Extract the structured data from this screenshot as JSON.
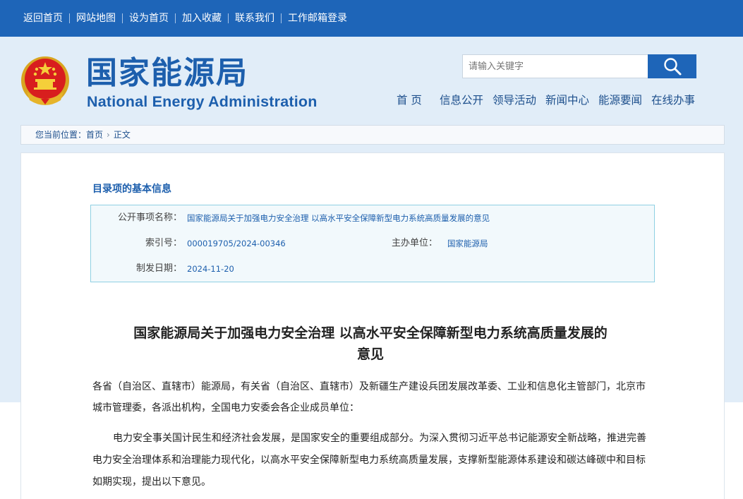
{
  "topnav": {
    "items": [
      "返回首页",
      "网站地图",
      "设为首页",
      "加入收藏",
      "联系我们",
      "工作邮箱登录"
    ]
  },
  "brand": {
    "name_cn": "国家能源局",
    "name_en": "National Energy Administration"
  },
  "search": {
    "placeholder": "请输入关键字",
    "icon": "search-icon"
  },
  "mainnav": {
    "items": [
      "首 页",
      "信息公开",
      "领导活动",
      "新闻中心",
      "能源要闻",
      "在线办事"
    ]
  },
  "breadcrumb": {
    "prefix": "您当前位置：",
    "home": "首页",
    "current": "正文"
  },
  "info": {
    "section_title": "目录项的基本信息",
    "title_label": "公开事项名称：",
    "title_value": "国家能源局关于加强电力安全治理 以高水平安全保障新型电力系统高质量发展的意见",
    "index_label": "索引号：",
    "index_value": "000019705/2024-00346",
    "org_label": "主办单位：",
    "org_value": "国家能源局",
    "date_label": "制发日期：",
    "date_value": "2024-11-20"
  },
  "document": {
    "title_line1": "国家能源局关于加强电力安全治理 以高水平安全保障新型电力系统高质量发展的",
    "title_line2": "意见",
    "addressee_line1": "各省（自治区、直辖市）能源局，有关省（自治区、直辖市）及新疆生产建设兵团发展改革委、工业和信息化主管部门，北京市",
    "addressee_line2": "城市管理委，各派出机构，全国电力安委会各企业成员单位：",
    "body_line1": "电力安全事关国计民生和经济社会发展，是国家安全的重要组成部分。为深入贯彻习近平总书记能源安全新战略，推进完善",
    "body_line2": "电力安全治理体系和治理能力现代化，以高水平安全保障新型电力系统高质量发展，支撑新型能源体系建设和碳达峰碳中和目标",
    "body_line3": "如期实现，提出以下意见。"
  },
  "colors": {
    "topbar": "#1e65b8",
    "header_bg": "#e1edf8",
    "brand": "#1d5fad",
    "info_border": "#8fd0e3",
    "info_bg": "#f2f9fc"
  }
}
